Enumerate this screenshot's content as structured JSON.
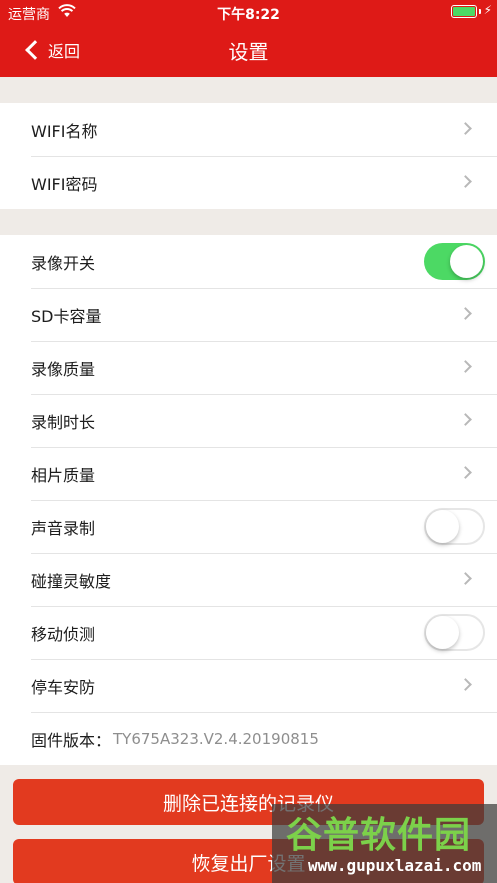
{
  "status_bar": {
    "carrier": "运营商",
    "time": "下午8:22",
    "battery_color": "#4cd964"
  },
  "nav": {
    "back_label": "返回",
    "title": "设置"
  },
  "group1": {
    "items": [
      {
        "label": "WIFI名称",
        "accessory": "chevron"
      },
      {
        "label": "WIFI密码",
        "accessory": "chevron"
      }
    ]
  },
  "group2": {
    "items": [
      {
        "label": "录像开关",
        "accessory": "toggle",
        "on": true
      },
      {
        "label": "SD卡容量",
        "accessory": "chevron"
      },
      {
        "label": "录像质量",
        "accessory": "chevron"
      },
      {
        "label": "录制时长",
        "accessory": "chevron"
      },
      {
        "label": "相片质量",
        "accessory": "chevron"
      },
      {
        "label": "声音录制",
        "accessory": "toggle",
        "on": false
      },
      {
        "label": "碰撞灵敏度",
        "accessory": "chevron"
      },
      {
        "label": "移动侦测",
        "accessory": "toggle",
        "on": false
      },
      {
        "label": "停车安防",
        "accessory": "chevron"
      }
    ],
    "version_label": "固件版本：",
    "version_value": "TY675A323.V2.4.20190815"
  },
  "buttons": {
    "delete_label": "删除已连接的记录仪",
    "reset_label": "恢复出厂设置"
  },
  "watermark": {
    "title": "谷普软件园",
    "url": "www.gupuxlazai.com"
  },
  "colors": {
    "header_red": "#de1a17",
    "button_red": "#e23a1f",
    "toggle_on": "#4cd964"
  }
}
